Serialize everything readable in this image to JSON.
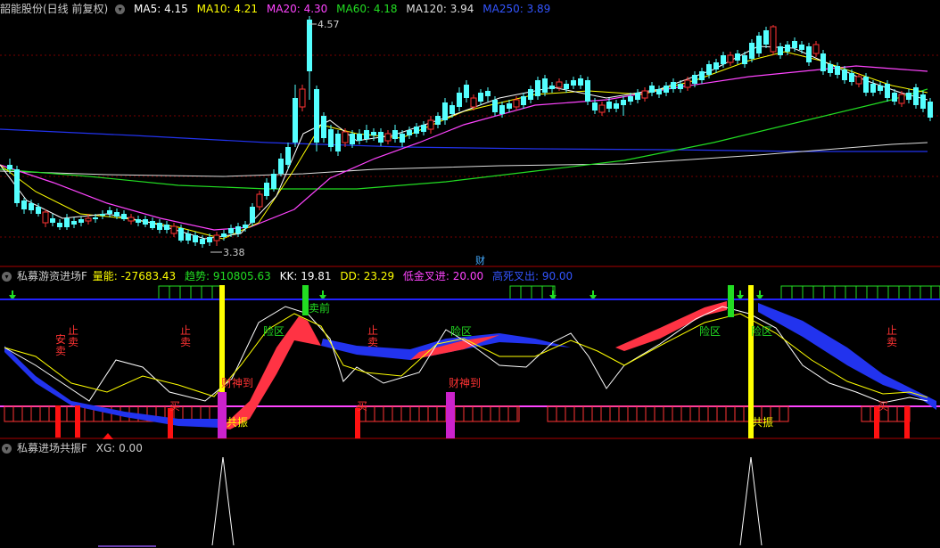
{
  "main": {
    "title": "韶能股份(日线 前复权)",
    "ma": [
      {
        "label": "MA5: 4.15",
        "color": "#ffffff"
      },
      {
        "label": "MA10: 4.21",
        "color": "#ffff00"
      },
      {
        "label": "MA20: 4.30",
        "color": "#ff44ff"
      },
      {
        "label": "MA60: 4.18",
        "color": "#22dd22"
      },
      {
        "label": "MA120: 3.94",
        "color": "#dddddd"
      },
      {
        "label": "MA250: 3.89",
        "color": "#3355ff"
      }
    ],
    "high_label": "4.57",
    "low_label": "3.38",
    "cai_label": "财"
  },
  "ind1": {
    "title": "私募游资进场F",
    "items": [
      {
        "label": "量能: -27683.43",
        "color": "#ffff00"
      },
      {
        "label": "趋势: 910805.63",
        "color": "#22dd22"
      },
      {
        "label": "KK: 19.81",
        "color": "#ffffff"
      },
      {
        "label": "DD: 23.29",
        "color": "#ffff00"
      },
      {
        "label": "低金叉进: 20.00",
        "color": "#ff44ff"
      },
      {
        "label": "高死叉出: 90.00",
        "color": "#3355ff"
      }
    ],
    "labels": {
      "stop_sell": "止卖",
      "safe_sell": "安卖",
      "danger_zone": "险区",
      "rich": "财神到",
      "buy": "买",
      "resonance": "共振",
      "sell_buy": "卖"
    }
  },
  "ind2": {
    "title": "私募进场共振F",
    "xg": "XG: 0.00"
  },
  "colors": {
    "up": "#ff3333",
    "down": "#54ffff",
    "axis_red": "#aa0000",
    "blue_line": "#2222ff",
    "magenta": "#ff44ff"
  }
}
